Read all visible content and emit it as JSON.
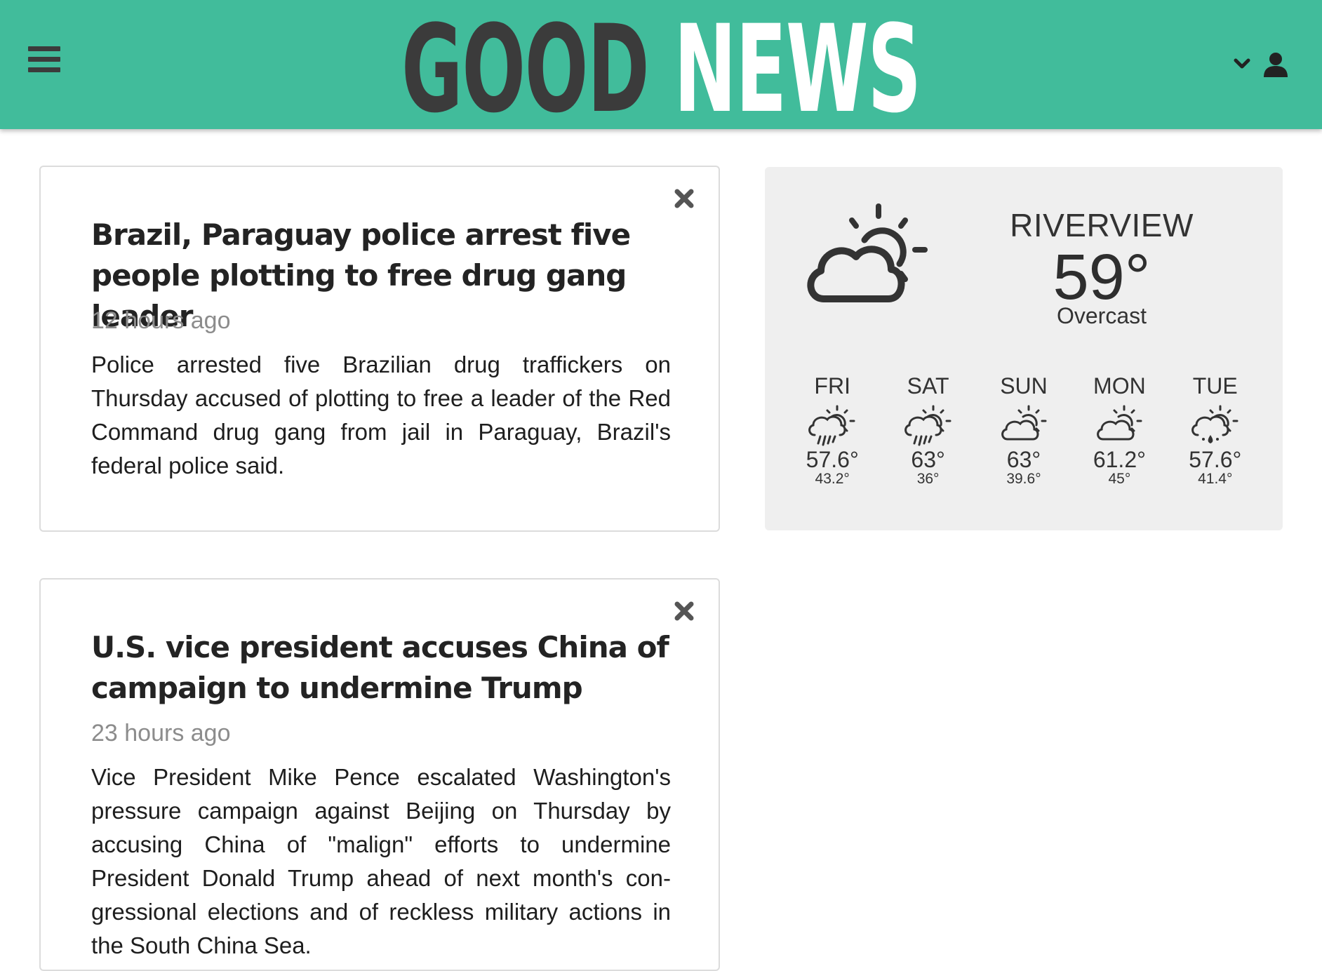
{
  "header": {
    "logo_word_1": "GOOD",
    "logo_word_2": "NEWS",
    "accent_color": "#41bc9b",
    "menu_icon": "hamburger-icon",
    "dropdown_icon": "chevron-down-icon",
    "account_icon": "user-icon"
  },
  "news": [
    {
      "title": "Brazil, Paraguay police arrest five people plotting to free drug gang leader",
      "time": "12 hours ago",
      "summary": "Police arrested five Brazilian drug traffickers on Thursday accused of plotting to free a leader of the Red Command drug gang from jail in Paraguay, Brazil's federal police said."
    },
    {
      "title": "U.S. vice president accuses China of campaign to undermine Trump",
      "time": "23 hours ago",
      "summary": "Vice President Mike Pence escalated Washington's pressure campaign against Beijing on Thursday by accusing China of \"malign\" efforts to undermine President Donald Trump ahead of next month's con­gressional elections and of reckless military actions in the South China Sea."
    }
  ],
  "weather": {
    "city": "RIVERVIEW",
    "temperature": "59°",
    "condition": "Overcast",
    "icon": "partly-cloudy-icon",
    "forecast": [
      {
        "day": "FRI",
        "high": "57.6°",
        "low": "43.2°",
        "icon": "rain-sun-icon"
      },
      {
        "day": "SAT",
        "high": "63°",
        "low": "36°",
        "icon": "rain-sun-icon"
      },
      {
        "day": "SUN",
        "high": "63°",
        "low": "39.6°",
        "icon": "partly-cloudy-icon"
      },
      {
        "day": "MON",
        "high": "61.2°",
        "low": "45°",
        "icon": "partly-cloudy-icon"
      },
      {
        "day": "TUE",
        "high": "57.6°",
        "low": "41.4°",
        "icon": "drizzle-sun-icon"
      }
    ]
  }
}
